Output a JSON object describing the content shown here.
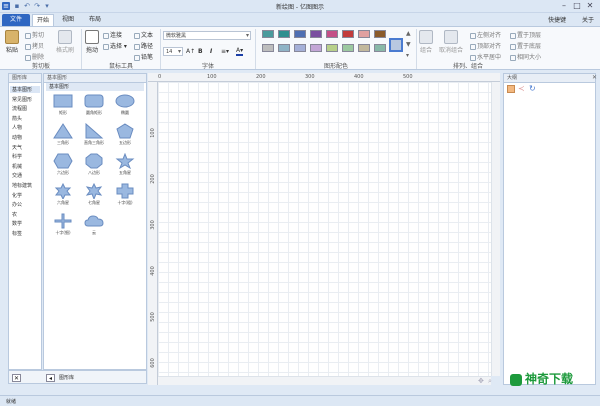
{
  "window": {
    "title": "新绘图 - 亿图图示"
  },
  "tabs": {
    "file": "文件",
    "home": "开始",
    "view": "视图",
    "layout": "布局"
  },
  "topright": {
    "shortcut": "快捷键",
    "about": "关于"
  },
  "ribbon": {
    "clipboard": {
      "paste": "粘贴",
      "cut": "剪切",
      "copy": "拷贝",
      "delete": "删除",
      "format_painter": "格式刷",
      "label": "剪切板"
    },
    "mouse": {
      "pan": "拖动",
      "connect": "连接",
      "text": "文本",
      "select": "选择",
      "path": "路径",
      "pen": "铅笔",
      "label": "鼠标工具"
    },
    "font": {
      "family": "微软雅黑",
      "size": "14",
      "bold": "B",
      "italic": "I",
      "label": "字体"
    },
    "colors": {
      "label": "图形配色",
      "row1": [
        "#4a9a9c",
        "#2f8f8f",
        "#4f6fb2",
        "#7a4fa0",
        "#c44f87",
        "#c23b3b",
        "#e0a0a0",
        "#8a5a2a"
      ],
      "row2": [
        "#bdbdbd",
        "#8fb3c6",
        "#a5b0d8",
        "#c3a6d6",
        "#b8d08a",
        "#9cc8a0",
        "#c2b89c",
        "#88b8a8"
      ]
    },
    "arrange": {
      "group": "组合",
      "ungroup": "取消组合",
      "align_left": "左侧对齐",
      "align_top": "顶部对齐",
      "align_center": "水平居中",
      "bring_top": "置于顶层",
      "send_bottom": "置于底层",
      "same_size": "相同大小",
      "label": "排列、组合"
    }
  },
  "library": {
    "header": "图形库",
    "items": [
      "基本图形",
      "常见图形",
      "流程图",
      "箭头",
      "人物",
      "动物",
      "天气",
      "科学",
      "机械",
      "交通",
      "地标建筑",
      "化学",
      "办公",
      "农",
      "数学",
      "标签"
    ],
    "panel_header": "基本图形",
    "section_title": "基本图形",
    "shapes": [
      "矩形",
      "圆角矩形",
      "椭圆",
      "三角形",
      "直角三角形",
      "五边形",
      "六边形",
      "八边形",
      "五角星",
      "六角星",
      "七角星",
      "十字(粗)",
      "十字(细)",
      "云"
    ],
    "footer": "图形库"
  },
  "ruler": {
    "top": [
      "0",
      "100",
      "200",
      "300",
      "400",
      "500"
    ],
    "left": [
      "100",
      "200",
      "300",
      "400",
      "500",
      "600"
    ]
  },
  "right_panel": {
    "header": "大纲"
  },
  "status": {
    "text": "就绪"
  },
  "watermark": {
    "text": "神奇下载"
  }
}
